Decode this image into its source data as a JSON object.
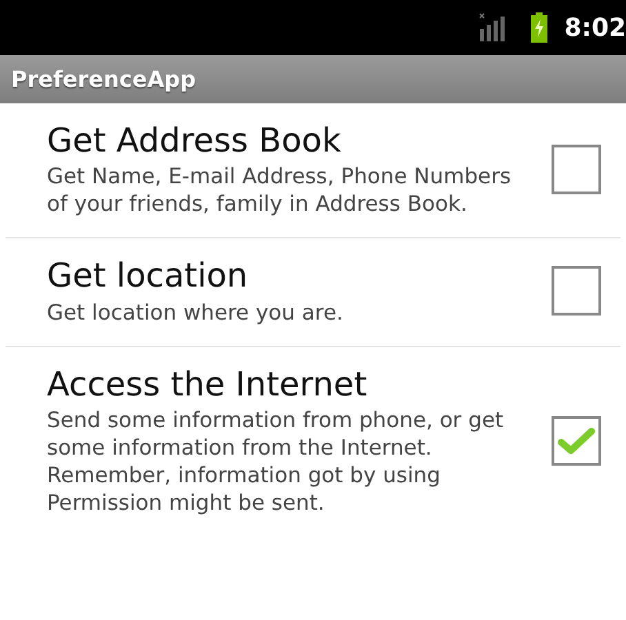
{
  "status_bar": {
    "time": "8:02"
  },
  "app_bar": {
    "title": "PreferenceApp"
  },
  "preferences": [
    {
      "title": "Get Address Book",
      "summary": "Get Name, E-mail Address, Phone Numbers of your friends, family in Address Book.",
      "checked": false
    },
    {
      "title": "Get location",
      "summary": "Get location where you are.",
      "checked": false
    },
    {
      "title": "Access the Internet",
      "summary": "Send some information from phone, or get some information from the Internet. Remember, information got by using Permission might be sent.",
      "checked": true
    }
  ]
}
